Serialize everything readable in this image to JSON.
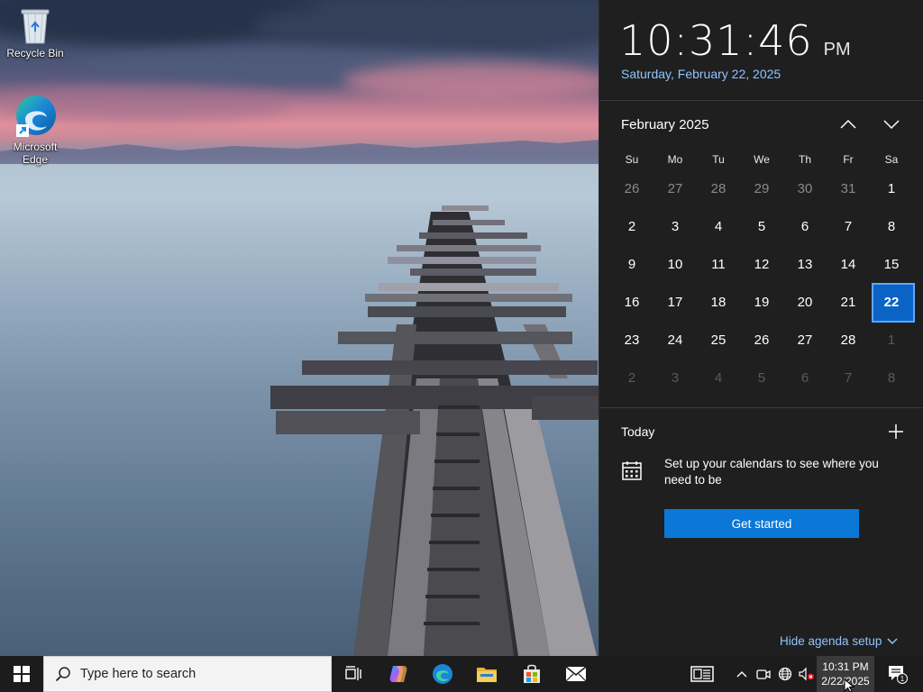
{
  "desktop": {
    "icons": [
      {
        "name": "recycle-bin",
        "label": "Recycle Bin"
      },
      {
        "name": "microsoft-edge",
        "label": "Microsoft Edge"
      }
    ]
  },
  "flyout": {
    "time": "10:31:46",
    "ampm": "PM",
    "date_long": "Saturday, February 22, 2025",
    "month_title": "February 2025",
    "weekdays": [
      "Su",
      "Mo",
      "Tu",
      "We",
      "Th",
      "Fr",
      "Sa"
    ],
    "weeks": [
      [
        "26",
        "27",
        "28",
        "29",
        "30",
        "31",
        "1"
      ],
      [
        "2",
        "3",
        "4",
        "5",
        "6",
        "7",
        "8"
      ],
      [
        "9",
        "10",
        "11",
        "12",
        "13",
        "14",
        "15"
      ],
      [
        "16",
        "17",
        "18",
        "19",
        "20",
        "21",
        "22"
      ],
      [
        "23",
        "24",
        "25",
        "26",
        "27",
        "28",
        "1"
      ],
      [
        "2",
        "3",
        "4",
        "5",
        "6",
        "7",
        "8"
      ]
    ],
    "today_day": "22",
    "today_title": "Today",
    "agenda_text": "Set up your calendars to see where you need to be",
    "get_started": "Get started",
    "hide_agenda": "Hide agenda setup"
  },
  "taskbar": {
    "search_placeholder": "Type here to search",
    "clock_time": "10:31 PM",
    "clock_date": "2/22/2025",
    "notification_count": "1"
  },
  "colors": {
    "accent": "#0b78d7",
    "today_fill": "#0b63c5",
    "link_blue": "#8fc4ff",
    "flyout_bg": "#1f1f1f"
  }
}
